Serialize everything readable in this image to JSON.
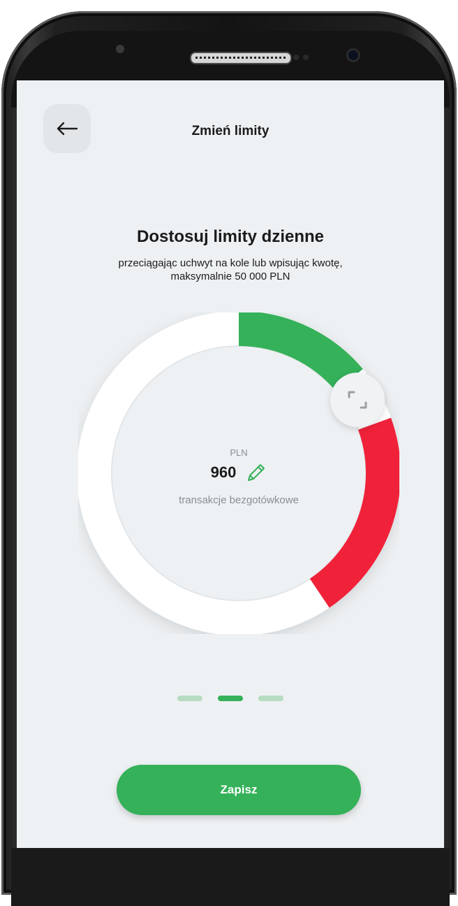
{
  "header": {
    "title": "Zmień limity",
    "back_icon": "arrow-left-icon"
  },
  "main": {
    "heading": "Dostosuj limity dzienne",
    "subtitle": "przeciągając uchwyt na kole lub wpisując kwotę, maksymalnie 50 000 PLN"
  },
  "dial": {
    "currency": "PLN",
    "amount": "960",
    "description": "transakcje bezgotówkowe",
    "edit_icon": "pencil-icon",
    "handle_icon": "drag-handle-icon",
    "colors": {
      "spent": "#35b15a",
      "remaining": "#f0223a",
      "track": "#ffffff"
    }
  },
  "pager": {
    "count": 3,
    "active_index": 1
  },
  "actions": {
    "save_label": "Zapisz"
  },
  "colors": {
    "accent": "#35b15a",
    "background": "#eef1f3"
  }
}
